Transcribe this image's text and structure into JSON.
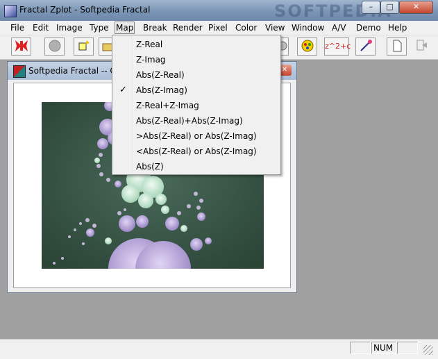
{
  "window": {
    "title": "Fractal Zplot - Softpedia Fractal",
    "watermark": "SOFTPEDIA"
  },
  "caption_buttons": {
    "minimize": "–",
    "maximize": "□",
    "close": "✕"
  },
  "menubar": [
    "File",
    "Edit",
    "Image",
    "Type",
    "Map",
    "Break",
    "Render",
    "Pixel",
    "Color",
    "View",
    "Window",
    "A/V",
    "Demo",
    "Help"
  ],
  "active_menu": "Map",
  "toolbar": {
    "formula_label": "z^2+c"
  },
  "map_menu": {
    "items": [
      {
        "label": "Z-Real",
        "checked": false
      },
      {
        "label": "Z-Imag",
        "checked": false
      },
      {
        "label": "Abs(Z-Real)",
        "checked": false
      },
      {
        "label": "Abs(Z-Imag)",
        "checked": true
      },
      {
        "label": "Z-Real+Z-Imag",
        "checked": false
      },
      {
        "label": "Abs(Z-Real)+Abs(Z-Imag)",
        "checked": false
      },
      {
        "label": ">Abs(Z-Real) or Abs(Z-Imag)",
        "checked": false
      },
      {
        "label": "<Abs(Z-Real) or Abs(Z-Imag)",
        "checked": false
      },
      {
        "label": "Abs(Z)",
        "checked": false
      }
    ],
    "check_glyph": "✓"
  },
  "child_window": {
    "title": "Softpedia Fractal -- C:\\",
    "close": "✕"
  },
  "statusbar": {
    "num": "NUM"
  },
  "colors": {
    "fractal_bg": "#2f4a3e",
    "petal_lavender": "#b9a6d8",
    "petal_mint": "#c8e6d0"
  }
}
